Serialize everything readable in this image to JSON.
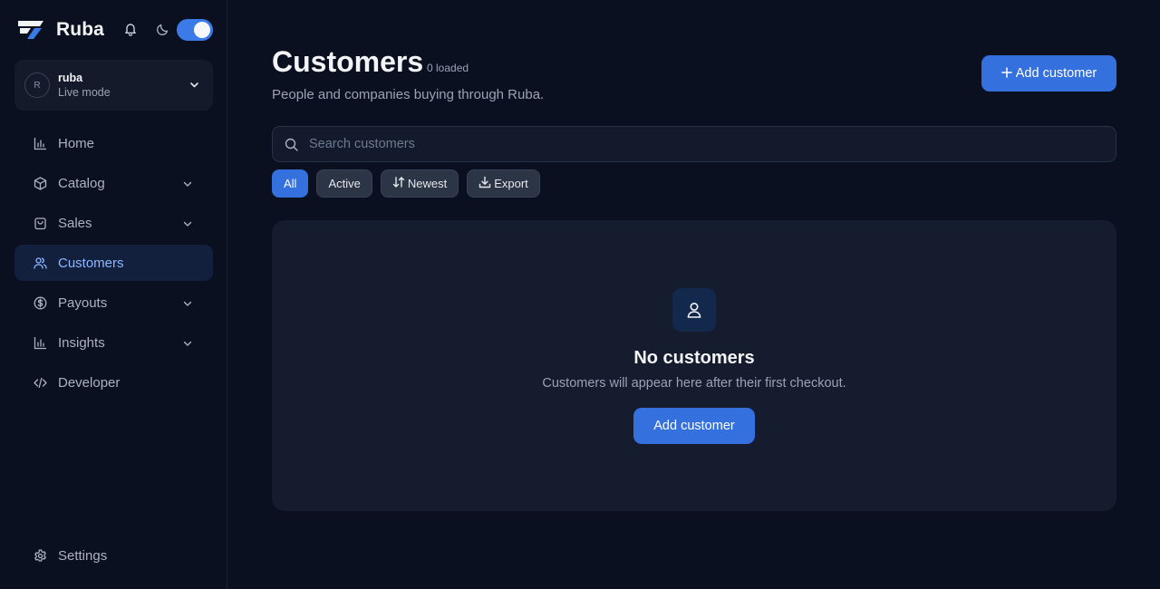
{
  "app": {
    "name": "Ruba"
  },
  "header_icons": {
    "notifications": "bell-icon",
    "theme": "moon-icon",
    "theme_toggle_on": true
  },
  "account": {
    "avatar_initial": "R",
    "name": "ruba",
    "mode": "Live mode"
  },
  "sidebar": {
    "items": [
      {
        "label": "Home",
        "icon": "chart-icon",
        "expandable": false,
        "active": false
      },
      {
        "label": "Catalog",
        "icon": "box-icon",
        "expandable": true,
        "active": false
      },
      {
        "label": "Sales",
        "icon": "bag-icon",
        "expandable": true,
        "active": false
      },
      {
        "label": "Customers",
        "icon": "users-icon",
        "expandable": false,
        "active": true
      },
      {
        "label": "Payouts",
        "icon": "dollar-circle-icon",
        "expandable": true,
        "active": false
      },
      {
        "label": "Insights",
        "icon": "chart-icon",
        "expandable": true,
        "active": false
      },
      {
        "label": "Developer",
        "icon": "code-icon",
        "expandable": false,
        "active": false
      }
    ],
    "settings": {
      "label": "Settings",
      "icon": "gear-icon"
    }
  },
  "page": {
    "title": "Customers",
    "count_text": "0 loaded",
    "subtitle": "People and companies buying through Ruba.",
    "add_button_label": "Add customer"
  },
  "search": {
    "placeholder": "Search customers",
    "value": ""
  },
  "filters": [
    {
      "label": "All",
      "active": true,
      "icon": ""
    },
    {
      "label": "Active",
      "active": false,
      "icon": ""
    },
    {
      "label": "Newest",
      "active": false,
      "icon": "sort-icon"
    },
    {
      "label": "Export",
      "active": false,
      "icon": "download-icon"
    }
  ],
  "empty_state": {
    "icon": "user-icon",
    "title": "No customers",
    "description": "Customers will appear here after their first checkout.",
    "button_label": "Add customer"
  },
  "colors": {
    "accent": "#3571de",
    "background": "#0b1020",
    "card": "#141c2d",
    "active_nav_bg": "#12203d",
    "active_nav_text": "#8fb7ff"
  }
}
